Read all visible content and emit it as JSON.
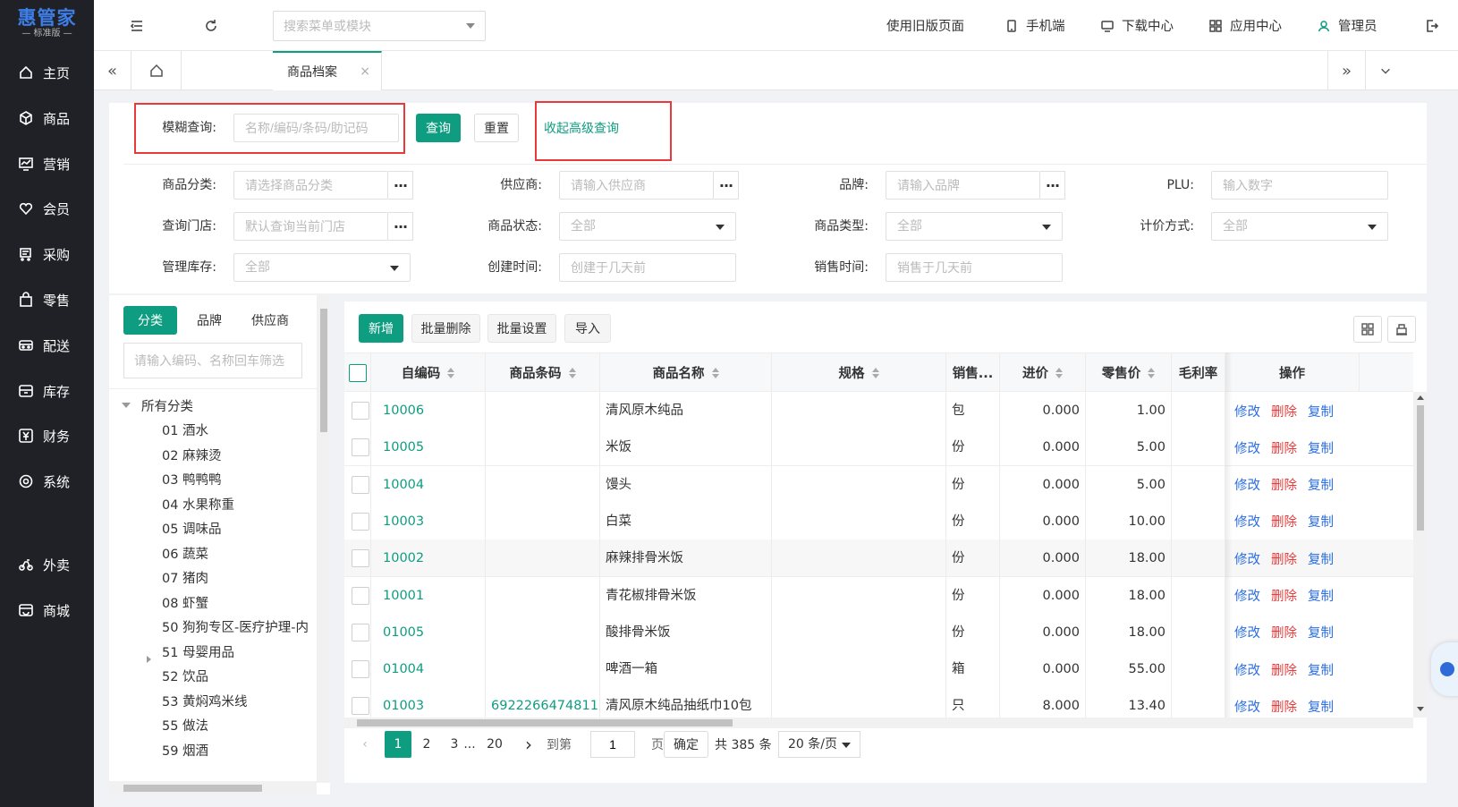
{
  "app": {
    "logo": "惠管家",
    "edition": "标准版"
  },
  "sidebar": {
    "items": [
      {
        "label": "主页",
        "icon": "home-icon"
      },
      {
        "label": "商品",
        "icon": "box-icon"
      },
      {
        "label": "营销",
        "icon": "chart-icon"
      },
      {
        "label": "会员",
        "icon": "heart-icon"
      },
      {
        "label": "采购",
        "icon": "cart-icon"
      },
      {
        "label": "零售",
        "icon": "bag-icon"
      },
      {
        "label": "配送",
        "icon": "truck-icon"
      },
      {
        "label": "库存",
        "icon": "archive-icon"
      },
      {
        "label": "财务",
        "icon": "yen-icon"
      },
      {
        "label": "系统",
        "icon": "gear-icon"
      },
      {
        "label": "外卖",
        "icon": "scooter-icon"
      },
      {
        "label": "商城",
        "icon": "store-icon"
      }
    ]
  },
  "header": {
    "search_placeholder": "搜索菜单或模块",
    "old_version": "使用旧版页面",
    "mobile": "手机端",
    "download": "下载中心",
    "apps": "应用中心",
    "user": "管理员"
  },
  "tabs": {
    "active": "商品档案",
    "close": "×"
  },
  "filter": {
    "fuzzy_label": "模糊查询:",
    "fuzzy_placeholder": "名称/编码/条码/助记码",
    "query_btn": "查询",
    "reset_btn": "重置",
    "collapse_link": "收起高级查询",
    "category_label": "商品分类:",
    "category_placeholder": "请选择商品分类",
    "supplier_label": "供应商:",
    "supplier_placeholder": "请输入供应商",
    "brand_label": "品牌:",
    "brand_placeholder": "请输入品牌",
    "plu_label": "PLU:",
    "plu_placeholder": "输入数字",
    "store_label": "查询门店:",
    "store_placeholder": "默认查询当前门店",
    "status_label": "商品状态:",
    "status_value": "全部",
    "type_label": "商品类型:",
    "type_value": "全部",
    "pricing_label": "计价方式:",
    "pricing_value": "全部",
    "stock_label": "管理库存:",
    "stock_value": "全部",
    "created_label": "创建时间:",
    "created_placeholder": "创建于几天前",
    "sold_label": "销售时间:",
    "sold_placeholder": "销售于几天前",
    "dots": "···"
  },
  "tree": {
    "tabs": [
      "分类",
      "品牌",
      "供应商"
    ],
    "search_placeholder": "请输入编码、名称回车筛选",
    "root": "所有分类",
    "items": [
      "01 酒水",
      "02 麻辣烫",
      "03 鸭鸭鸭",
      "04 水果称重",
      "05 调味品",
      "06 蔬菜",
      "07 猪肉",
      "08 虾蟹",
      "50 狗狗专区-医疗护理-内",
      "51 母婴用品",
      "52 饮品",
      "53 黄焖鸡米线",
      "55 做法",
      "59 烟酒"
    ]
  },
  "toolbar": {
    "add": "新增",
    "batch_delete": "批量删除",
    "batch_set": "批量设置",
    "import": "导入"
  },
  "table": {
    "columns": [
      "自编码",
      "商品条码",
      "商品名称",
      "规格",
      "销售...",
      "进价",
      "零售价",
      "毛利率",
      "操作"
    ],
    "rows": [
      {
        "code": "10006",
        "barcode": "",
        "name": "清风原木纯品",
        "spec": "",
        "unit": "包",
        "cost": "0.000",
        "price": "1.00"
      },
      {
        "code": "10005",
        "barcode": "",
        "name": "米饭",
        "spec": "",
        "unit": "份",
        "cost": "0.000",
        "price": "5.00"
      },
      {
        "code": "10004",
        "barcode": "",
        "name": "馒头",
        "spec": "",
        "unit": "份",
        "cost": "0.000",
        "price": "5.00"
      },
      {
        "code": "10003",
        "barcode": "",
        "name": "白菜",
        "spec": "",
        "unit": "份",
        "cost": "0.000",
        "price": "10.00"
      },
      {
        "code": "10002",
        "barcode": "",
        "name": "麻辣排骨米饭",
        "spec": "",
        "unit": "份",
        "cost": "0.000",
        "price": "18.00"
      },
      {
        "code": "10001",
        "barcode": "",
        "name": "青花椒排骨米饭",
        "spec": "",
        "unit": "份",
        "cost": "0.000",
        "price": "18.00"
      },
      {
        "code": "01005",
        "barcode": "",
        "name": "酸排骨米饭",
        "spec": "",
        "unit": "份",
        "cost": "0.000",
        "price": "18.00"
      },
      {
        "code": "01004",
        "barcode": "",
        "name": "啤酒一箱",
        "spec": "",
        "unit": "箱",
        "cost": "0.000",
        "price": "55.00"
      },
      {
        "code": "01003",
        "barcode": "6922266474811",
        "name": "清风原木纯品抽纸巾10包",
        "spec": "",
        "unit": "只",
        "cost": "8.000",
        "price": "13.40"
      }
    ],
    "ops": {
      "edit": "修改",
      "delete": "删除",
      "copy": "复制"
    }
  },
  "pagination": {
    "pages": [
      "1",
      "2",
      "3",
      "...",
      "20"
    ],
    "goto": "到第",
    "page_value": "1",
    "page_unit": "页",
    "confirm": "确定",
    "total": "共 385 条",
    "page_size": "20 条/页"
  }
}
